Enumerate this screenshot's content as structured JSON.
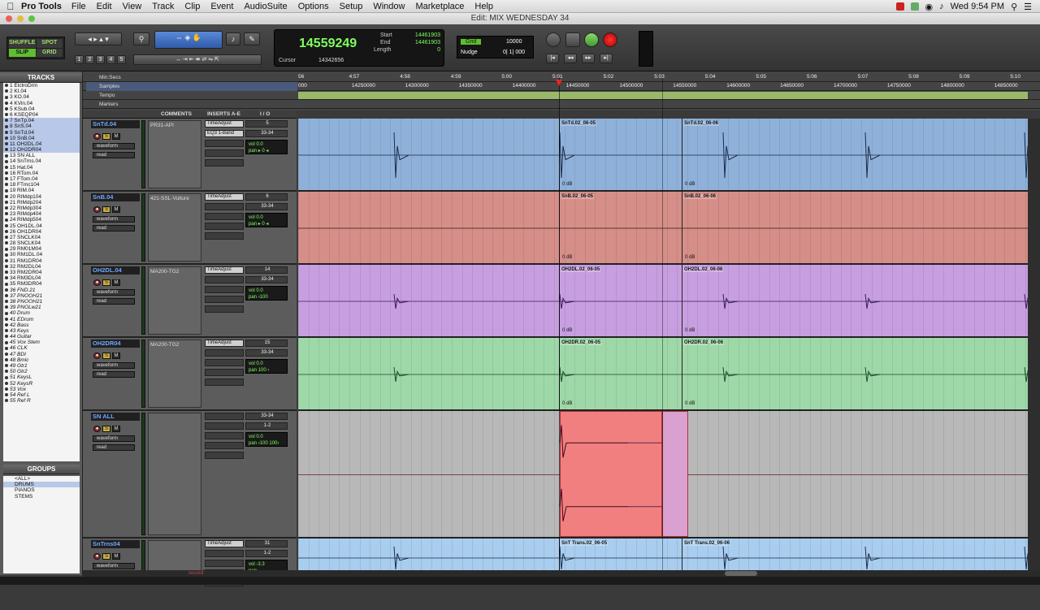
{
  "menubar": {
    "app": "Pro Tools",
    "items": [
      "File",
      "Edit",
      "View",
      "Track",
      "Clip",
      "Event",
      "AudioSuite",
      "Options",
      "Setup",
      "Window",
      "Marketplace",
      "Help"
    ],
    "clock": "Wed 9:54 PM"
  },
  "window": {
    "title": "Edit: MIX WEDNESDAY 34"
  },
  "toolbar": {
    "modes": [
      "SHUFFLE",
      "SPOT",
      "SLIP",
      "GRID"
    ],
    "zoom_presets": [
      "1",
      "2",
      "3",
      "4",
      "5"
    ],
    "main_counter": "14559249",
    "start_label": "Start",
    "end_label": "End",
    "length_label": "Length",
    "start": "14461903",
    "end": "14461903",
    "length": "0",
    "cursor_label": "Cursor",
    "cursor_value": "14342656",
    "grid_label": "Grid",
    "grid_value": "10000",
    "nudge_label": "Nudge",
    "nudge_value": "0| 1| 000"
  },
  "tracks_panel": {
    "title": "TRACKS",
    "items": [
      "1 ElctroDrm",
      "2 KI.04",
      "3 KO.04",
      "4 KVin.04",
      "5 KSub.04",
      "6 KSEQP04",
      "7 SnTp.04",
      "8 SnS.04",
      "9 SnTd.04",
      "10 SnB.04",
      "11 OH2DL.04",
      "12 OH2DR04",
      "13 SN ALL",
      "14 SnTrns.04",
      "15 Hat.04",
      "16 RTom.04",
      "17 FTom.04",
      "18 FTmc104",
      "19 RIM.04",
      "20 RIMdp104",
      "21 RIMdp204",
      "22 RIMdp304",
      "23 RIMdp404",
      "24 RIMdp504",
      "25 OH1DL.04",
      "26 OH1DR04",
      "27 SNCLK04",
      "28 SNCLK04",
      "29 RM01M04",
      "30 RM1DL.04",
      "31 RM1DR04",
      "32 RM2DL04",
      "33 RM2DR04",
      "34 RM3DL04",
      "35 RM3DR04",
      "36 FND.21",
      "37 PNOOH21",
      "38 PNOOH21",
      "39 PNOLw21",
      "40 Drum",
      "41 EDrum",
      "42 Bass",
      "43 Keys",
      "44 Guitar",
      "45 Vox Stem",
      "46 CLK",
      "47 BDI",
      "48 Bmic",
      "49 Gtr1",
      "50 Gtr2",
      "51 KeysL",
      "52 KeysR",
      "53 Vox",
      "54 Ref L",
      "55 Ref R"
    ]
  },
  "groups_panel": {
    "title": "GROUPS",
    "items": [
      "<ALL>",
      "DRUMS",
      "PIANOS",
      "STEMS"
    ]
  },
  "rulers": {
    "minsecs_label": "Min:Secs",
    "samples_label": "Samples",
    "tempo_label": "Tempo",
    "markers_label": "Markers",
    "minsecs_ticks": [
      "56",
      "4:57",
      "4:58",
      "4:59",
      "5:00",
      "5:01",
      "5:02",
      "5:03",
      "5:04",
      "5:05",
      "5:06",
      "5:07",
      "5:08",
      "5:09",
      "5:10"
    ],
    "sample_ticks": [
      "000",
      "14250000",
      "14300000",
      "14350000",
      "14400000",
      "14450000",
      "14500000",
      "14550000",
      "14600000",
      "14650000",
      "14700000",
      "14750000",
      "14800000",
      "14850000"
    ]
  },
  "columns": {
    "comments": "COMMENTS",
    "inserts": "INSERTS A-E",
    "io": "I / O"
  },
  "tracks": [
    {
      "name": "SnTd.04",
      "comment": "PR31-API",
      "inserts": [
        "TimeAdjust",
        "EQ3 1-Band"
      ],
      "input": "5",
      "output": "33-34",
      "vol": "0.0",
      "pan": "▸ 0 ◂",
      "view": "waveform",
      "auto": "read",
      "clips": [
        {
          "label": "SnTd.02_06-05"
        },
        {
          "label": "SnTd.02_06-06"
        }
      ],
      "db": "0 dB",
      "color": "#8fb1d9",
      "wave": "#1a2a4a"
    },
    {
      "name": "SnB.04",
      "comment": "421-SSL-Vulture",
      "inserts": [
        "TimeAdjust"
      ],
      "input": "6",
      "output": "33-34",
      "vol": "0.0",
      "pan": "▸ 0 ◂",
      "view": "waveform",
      "auto": "read",
      "clips": [
        {
          "label": "SnB.02_06-05"
        },
        {
          "label": "SnB.02_06-06"
        }
      ],
      "db": "0 dB",
      "color": "#d58e88",
      "wave": "#3a1a1a"
    },
    {
      "name": "OH2DL.04",
      "comment": "MA200-TG2",
      "inserts": [
        "TimeAdjust"
      ],
      "input": "14",
      "output": "33-34",
      "vol": "0.0",
      "pan": "‹100",
      "view": "waveform",
      "auto": "read",
      "clips": [
        {
          "label": "OH2DL.02_06-05"
        },
        {
          "label": "OH2DL.02_06-06"
        }
      ],
      "db": "0 dB",
      "color": "#c79fe0",
      "wave": "#3a1a5a"
    },
    {
      "name": "OH2DR04",
      "comment": "MA200-TG2",
      "inserts": [
        "TimeAdjust"
      ],
      "input": "15",
      "output": "33-34",
      "vol": "0.0",
      "pan": "100 ›",
      "view": "waveform",
      "auto": "read",
      "clips": [
        {
          "label": "OH2DR.02_06-05"
        },
        {
          "label": "OH2DR.02_06-06"
        }
      ],
      "db": "0 dB",
      "color": "#9fd8a8",
      "wave": "#1a4a2a"
    },
    {
      "name": "SN ALL",
      "comment": "",
      "inserts": [],
      "input": "33-34",
      "output": "1-2",
      "vol": "0.0",
      "pan": "‹100  100›",
      "view": "waveform",
      "auto": "read",
      "clips": [],
      "db": "",
      "color": "#b8b8b8",
      "wave": "#6a1a2a"
    },
    {
      "name": "SnTrns04",
      "comment": "",
      "inserts": [
        "TimeAdjust"
      ],
      "input": "31",
      "output": "1-2",
      "vol": "-3.3",
      "pan": "",
      "view": "waveform",
      "auto": "read",
      "clips": [
        {
          "label": "SnT Trans.02_06-05"
        },
        {
          "label": "SnT Trans.02_06-06"
        }
      ],
      "db": "",
      "color": "#a9cdee",
      "wave": "#1a2a4a"
    }
  ],
  "status": {
    "record_hint": "record"
  }
}
